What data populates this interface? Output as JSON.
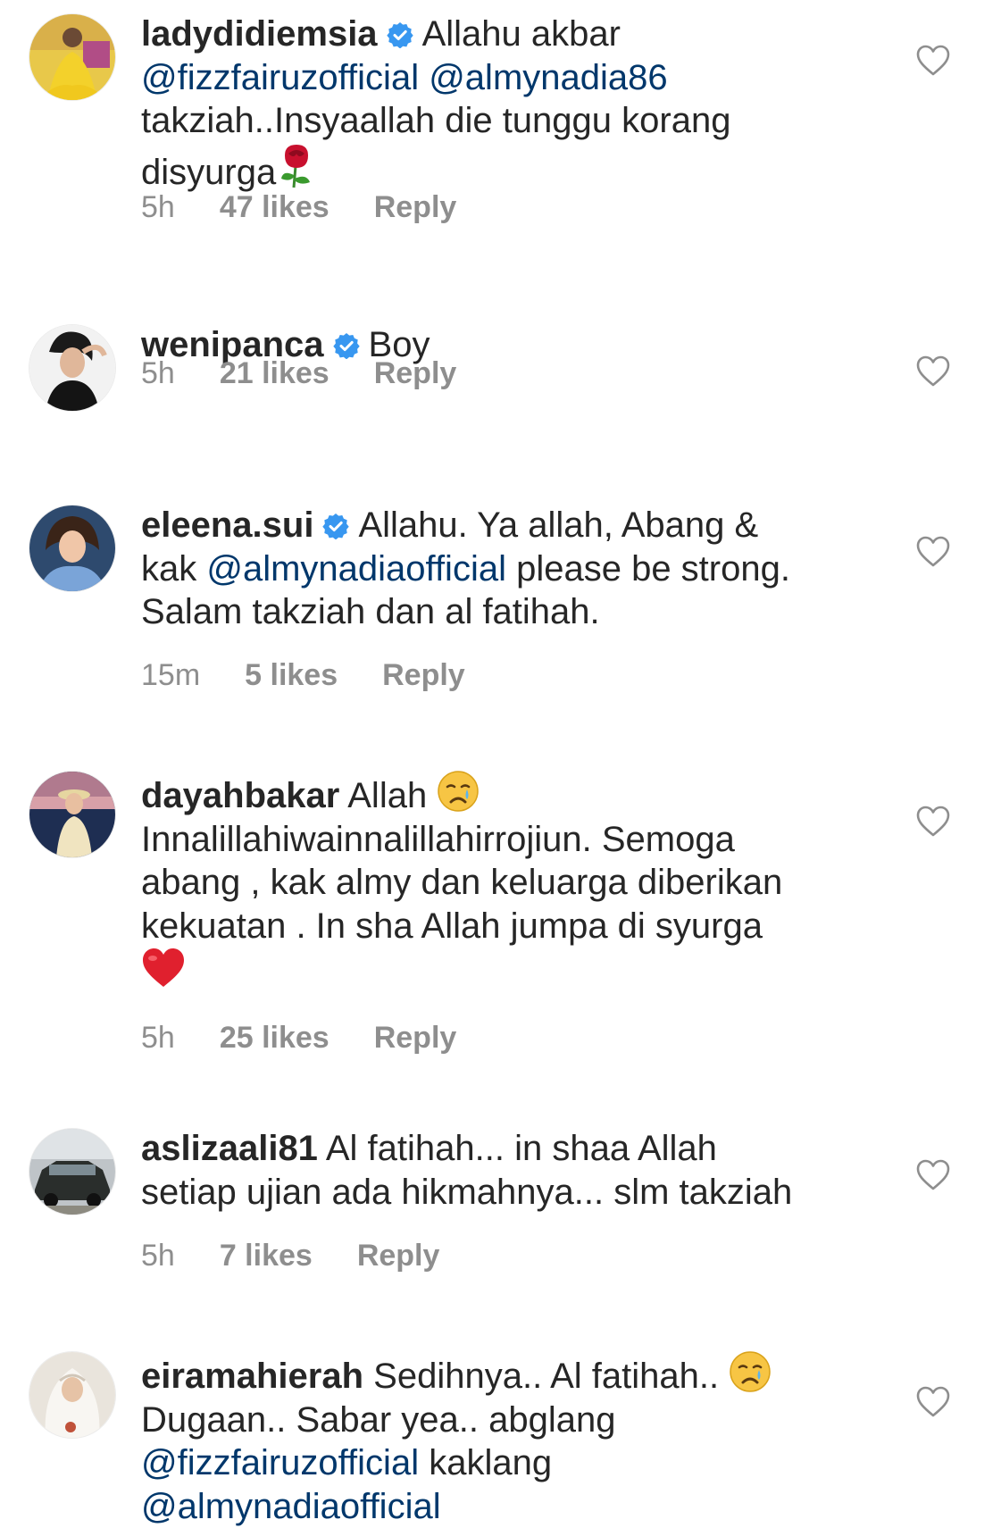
{
  "colors": {
    "text": "#262626",
    "mention": "#00376b",
    "meta": "#8e8e8e",
    "verified": "#3897f0",
    "background": "#ffffff"
  },
  "comments": [
    {
      "username": "ladydidiemsia",
      "verified": true,
      "parts": [
        "Allahu akbar",
        "@fizzfairuzofficial",
        "@almynadia86",
        "takziah..Insyaallah die tunggu korang",
        "disyurga"
      ],
      "emoji": "rose-emoji",
      "time": "5h",
      "likes": "47 likes",
      "reply": "Reply",
      "like_icon": "heart-outline-icon"
    },
    {
      "username": "wenipanca",
      "verified": true,
      "parts": [
        "Boy"
      ],
      "time": "5h",
      "likes": "21 likes",
      "reply": "Reply",
      "like_icon": "heart-outline-icon"
    },
    {
      "username": "eleena.sui",
      "verified": true,
      "parts": [
        "Allahu. Ya allah, Abang &",
        "kak",
        "@almynadiaofficial",
        "please be strong.",
        "Salam takziah dan al fatihah."
      ],
      "time": "15m",
      "likes": "5 likes",
      "reply": "Reply",
      "like_icon": "heart-outline-icon"
    },
    {
      "username": "dayahbakar",
      "verified": false,
      "parts": [
        "Allah",
        "Innalillahiwainnalillahirrojiun. Semoga",
        "abang , kak almy dan keluarga diberikan",
        "kekuatan . In sha Allah jumpa di syurga"
      ],
      "emoji": "crying-face-emoji, red-heart-emoji",
      "time": "5h",
      "likes": "25 likes",
      "reply": "Reply",
      "like_icon": "heart-outline-icon"
    },
    {
      "username": "aslizaali81",
      "verified": false,
      "parts": [
        "Al fatihah... in shaa Allah",
        "setiap ujian ada hikmahnya... slm takziah"
      ],
      "time": "5h",
      "likes": "7 likes",
      "reply": "Reply",
      "like_icon": "heart-outline-icon"
    },
    {
      "username": "eiramahierah",
      "verified": false,
      "parts": [
        "Sedihnya.. Al fatihah..",
        "Dugaan.. Sabar yea.. abglang",
        "@fizzfairuzofficial",
        "kaklang",
        "@almynadiaofficial"
      ],
      "emoji": "crying-face-emoji",
      "like_icon": "heart-outline-icon"
    }
  ]
}
